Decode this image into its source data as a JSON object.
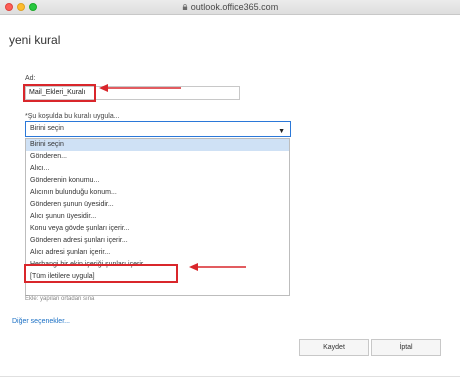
{
  "browser": {
    "url": "outlook.office365.com"
  },
  "page": {
    "title": "yeni kural"
  },
  "form": {
    "name_label": "Ad:",
    "name_value": "Mail_Ekleri_Kuralı",
    "condition_label": "*Şu koşulda bu kuralı uygula...",
    "condition_selected": "Birini seçin"
  },
  "dropdown": {
    "options": [
      "Birini seçin",
      "Gönderen...",
      "Alıcı...",
      "Gönderenin konumu...",
      "Alıcının bulunduğu konum...",
      "Gönderen şunun üyesidir...",
      "Alıcı şunun üyesidir...",
      "Konu veya gövde şunları içerir...",
      "Gönderen adresi şunları içerir...",
      "Alıcı adresi şunları içerir...",
      "Herhangi bir ekin içeriği şunları içerir...",
      "[Tüm iletilere uygula]"
    ],
    "behind_text": "Ekle: yapılan ortadan sına"
  },
  "links": {
    "more_options": "Diğer seçenekler..."
  },
  "buttons": {
    "save": "Kaydet",
    "cancel": "İptal"
  },
  "colors": {
    "annotation_red": "#d9262b",
    "focus_blue": "#2b78d8",
    "link_blue": "#1a6fc4"
  }
}
